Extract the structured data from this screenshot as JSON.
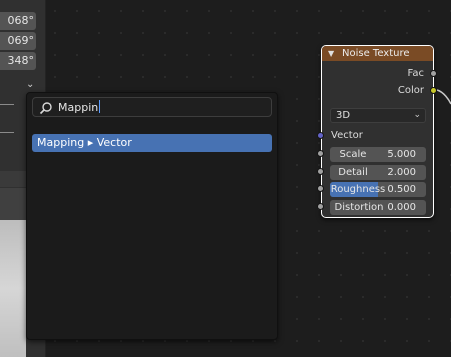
{
  "properties_panel": {
    "rotation_values": [
      "068°",
      "069°",
      "348°"
    ]
  },
  "search_popup": {
    "query": "Mappin",
    "results": [
      {
        "label": "Mapping ▸ Vector"
      }
    ]
  },
  "node": {
    "title": "Noise Texture",
    "header_color": "#7a4b25",
    "outputs": [
      {
        "label": "Fac",
        "socket_color": "#a1a1a1"
      },
      {
        "label": "Color",
        "socket_color": "#c7c729"
      }
    ],
    "dimensions": "3D",
    "vector_label": "Vector",
    "vector_socket_color": "#6363c7",
    "inputs": [
      {
        "label": "Scale",
        "value": "5.000",
        "highlighted": false
      },
      {
        "label": "Detail",
        "value": "2.000",
        "highlighted": false
      },
      {
        "label": "Roughness",
        "value": "0.500",
        "highlighted": true,
        "fill": 0.5
      },
      {
        "label": "Distortion",
        "value": "0.000",
        "highlighted": false
      }
    ]
  },
  "colors": {
    "accent": "#4772b3",
    "background": "#1d1d1d"
  }
}
